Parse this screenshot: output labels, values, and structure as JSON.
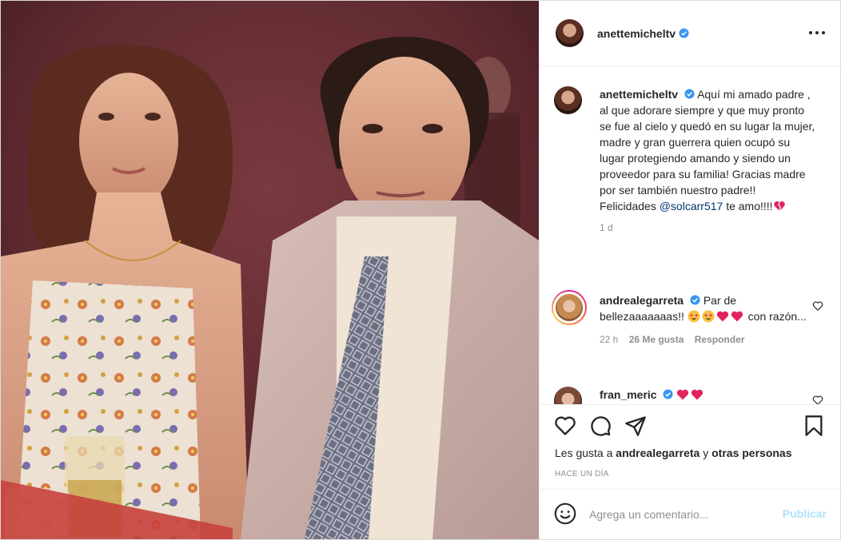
{
  "post": {
    "username": "anettemicheltv",
    "more_options_icon": "more-horizontal-icon",
    "verified_icon": "verified-badge-icon"
  },
  "caption": {
    "username": "anettemicheltv",
    "text": "Aquí mi amado padre , al que adorare siempre y que muy pronto se fue al cielo y quedó en su lugar la mujer, madre y gran guerrera quien ocupó su lugar protegiendo amando y siendo un proveedor para su familia! Gracias madre por ser también nuestro padre!! Felicidades",
    "mention": "@solcarr517",
    "text_after": "te amo!!!!",
    "time": "1 d"
  },
  "comments": [
    {
      "username": "andrealegarreta",
      "text_before": "Par de bellezaaaaaaas!!",
      "text_after": "con razón...",
      "time": "22 h",
      "likes": "26 Me gusta",
      "reply": "Responder"
    },
    {
      "username": "fran_meric",
      "text_before": ""
    }
  ],
  "actions": {
    "like_icon": "heart-icon",
    "comment_icon": "comment-icon",
    "share_icon": "paper-plane-icon",
    "save_icon": "bookmark-icon",
    "likes_prefix": "Les gusta a",
    "likes_user": "andrealegarreta",
    "likes_mid": "y",
    "likes_others": "otras personas",
    "posted_ago": "HACE UN DÍA"
  },
  "add_comment": {
    "emoji_icon": "smiley-icon",
    "placeholder": "Agrega un comentario...",
    "publish_label": "Publicar"
  },
  "colors": {
    "link": "#00376b",
    "publish_disabled": "#b2dffc",
    "heart_red": "#ed4956",
    "verified_blue": "#3897f0"
  }
}
